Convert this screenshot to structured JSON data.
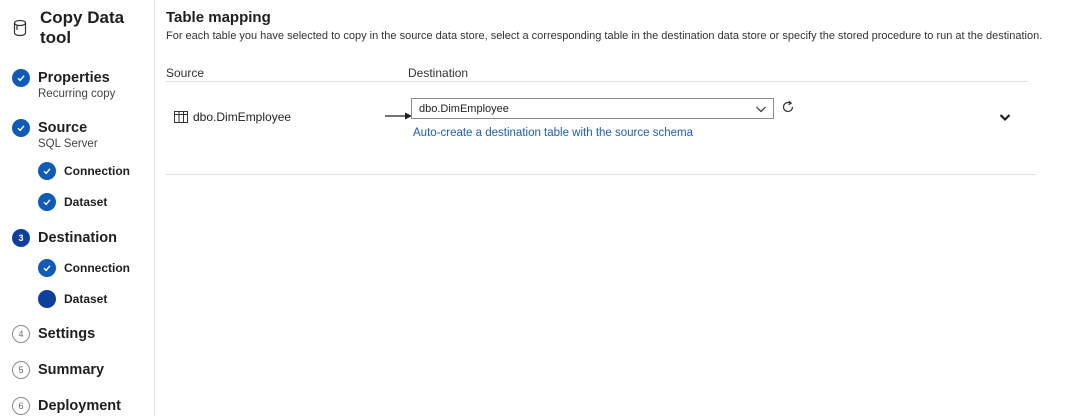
{
  "app": {
    "title": "Copy Data tool"
  },
  "steps": [
    {
      "label": "Properties",
      "sub": "Recurring copy",
      "state": "done"
    },
    {
      "label": "Source",
      "sub": "SQL Server",
      "state": "done",
      "children": [
        {
          "label": "Connection",
          "state": "done"
        },
        {
          "label": "Dataset",
          "state": "done"
        }
      ]
    },
    {
      "label": "Destination",
      "num": "3",
      "state": "current",
      "children": [
        {
          "label": "Connection",
          "state": "done"
        },
        {
          "label": "Dataset",
          "state": "active"
        }
      ]
    },
    {
      "label": "Settings",
      "num": "4",
      "state": "todo"
    },
    {
      "label": "Summary",
      "num": "5",
      "state": "todo"
    },
    {
      "label": "Deployment",
      "num": "6",
      "state": "todo"
    }
  ],
  "main": {
    "title": "Table mapping",
    "description": "For each table you have selected to copy in the source data store, select a corresponding table in the destination data store or specify the stored procedure to run at the destination.",
    "columns": {
      "source": "Source",
      "destination": "Destination"
    },
    "rows": [
      {
        "source_table": "dbo.DimEmployee",
        "destination_table": "dbo.DimEmployee",
        "auto_create_link": "Auto-create a destination table with the source schema"
      }
    ]
  },
  "colors": {
    "accent": "#0f5bb5",
    "link": "#1b5fb5"
  },
  "icons": {
    "app": "copy-data-icon",
    "check": "check-icon",
    "table": "table-icon",
    "arrow": "arrow-right-icon",
    "chevron": "chevron-down-icon",
    "refresh": "refresh-icon"
  }
}
